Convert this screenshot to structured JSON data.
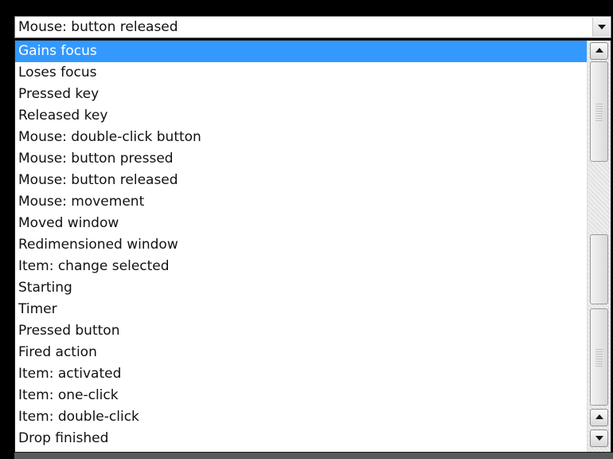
{
  "combo": {
    "value": "Mouse: button released"
  },
  "dropdown": {
    "selected_index": 0,
    "items": [
      {
        "label": "Gains focus"
      },
      {
        "label": "Loses focus"
      },
      {
        "label": "Pressed key"
      },
      {
        "label": "Released key"
      },
      {
        "label": "Mouse: double-click button"
      },
      {
        "label": "Mouse: button pressed"
      },
      {
        "label": "Mouse: button released"
      },
      {
        "label": "Mouse: movement"
      },
      {
        "label": "Moved window"
      },
      {
        "label": "Redimensioned window"
      },
      {
        "label": "Item: change selected"
      },
      {
        "label": "Starting"
      },
      {
        "label": "Timer"
      },
      {
        "label": "Pressed button"
      },
      {
        "label": "Fired action"
      },
      {
        "label": "Item: activated"
      },
      {
        "label": "Item: one-click"
      },
      {
        "label": "Item: double-click"
      },
      {
        "label": "Drop finished"
      }
    ]
  },
  "colors": {
    "selection": "#3399ff",
    "selection_text": "#ffffff",
    "background": "#000000"
  },
  "icons": {
    "combo_arrow": "chevron-down-icon",
    "scroll_up": "arrow-up-icon",
    "scroll_down": "arrow-down-icon"
  }
}
